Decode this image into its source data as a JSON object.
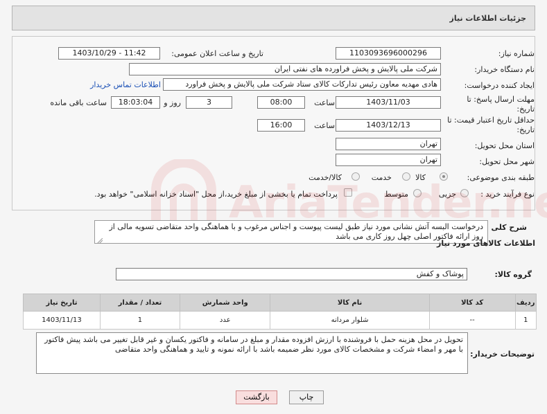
{
  "header": {
    "title": "جزئیات اطلاعات نیاز"
  },
  "form": {
    "need_number": {
      "label": "شماره نیاز:",
      "value": "1103093696000296"
    },
    "announce_datetime": {
      "label": "تاریخ و ساعت اعلان عمومی:",
      "value": "1403/10/29 - 11:42"
    },
    "buyer_org": {
      "label": "نام دستگاه خریدار:",
      "value": "شرکت ملی پالایش و پخش فراورده های نفتی ایران"
    },
    "requester": {
      "label": "ایجاد کننده درخواست:",
      "value": "هادی مهدیه معاون رئیس تدارکات کالای ستاد شرکت ملی پالایش و پخش فراورد",
      "contact_link": "اطلاعات تماس خریدار"
    },
    "response_deadline": {
      "label_line1": "مهلت ارسال پاسخ: تا",
      "label_line2": "تاریخ:",
      "date": "1403/11/03",
      "time_label": "ساعت",
      "time": "08:00",
      "days": "3",
      "days_label": "روز و",
      "remaining": "18:03:04",
      "remaining_label": "ساعت باقی مانده"
    },
    "price_validity": {
      "label_line1": "حداقل تاریخ اعتبار قیمت: تا",
      "label_line2": "تاریخ:",
      "date": "1403/12/13",
      "time_label": "ساعت",
      "time": "16:00"
    },
    "delivery_province": {
      "label": "استان محل تحویل:",
      "value": "تهران"
    },
    "delivery_city": {
      "label": "شهر محل تحویل:",
      "value": "تهران"
    },
    "category": {
      "label": "طبقه بندی موضوعی:",
      "options": [
        "کالا",
        "خدمت",
        "کالا/خدمت"
      ],
      "selected": "کالا"
    },
    "purchase_type": {
      "label": "نوع فرآیند خرید :",
      "options": [
        "جزیی",
        "متوسط"
      ],
      "selected": "",
      "payment_checkbox_label": "پرداخت تمام یا بخشی از مبلغ خرید،از محل \"اسناد خزانه اسلامی\" خواهد بود."
    }
  },
  "description": {
    "label": "شرح کلی نیاز:",
    "text": "درخواست البسه آتش نشانی مورد نیاز طبق لیست پیوست و اجناس مرغوب و با هماهنگی واحد متقاضی تسویه مالی از روز ارائه فاکتور اصلی  چهل روز کاری می باشد"
  },
  "goods_info": {
    "section_title": "اطلاعات کالاهای مورد نیاز",
    "group_label": "گروه کالا:",
    "group_value": "پوشاک و کفش"
  },
  "table": {
    "headers": [
      "ردیف",
      "کد کالا",
      "نام کالا",
      "واحد شمارش",
      "تعداد / مقدار",
      "تاریخ نیاز"
    ],
    "rows": [
      [
        "1",
        "--",
        "شلوار مردانه",
        "عدد",
        "1",
        "1403/11/13"
      ]
    ]
  },
  "buyer_notes": {
    "label": "توضیحات خریدار:",
    "text": "تحویل در محل هزینه  حمل با فروشنده با ارزش افزوده مقدار و مبلغ در سامانه و فاکتور یکسان و غیر قابل تغییر می باشد پیش فاکتور با مهر و امضاء شرکت و مشخصات کالای مورد نظر ضمیمه باشد با ارائه نمونه و تایید و هماهنگی واحد متقاضی"
  },
  "buttons": {
    "print": "چاپ",
    "back": "بازگشت"
  },
  "watermark": {
    "text": "AriaTender.neT"
  },
  "colors": {
    "link": "#1a4fb5",
    "back_button": "#f9dede",
    "table_header": "#d3d3d3"
  }
}
